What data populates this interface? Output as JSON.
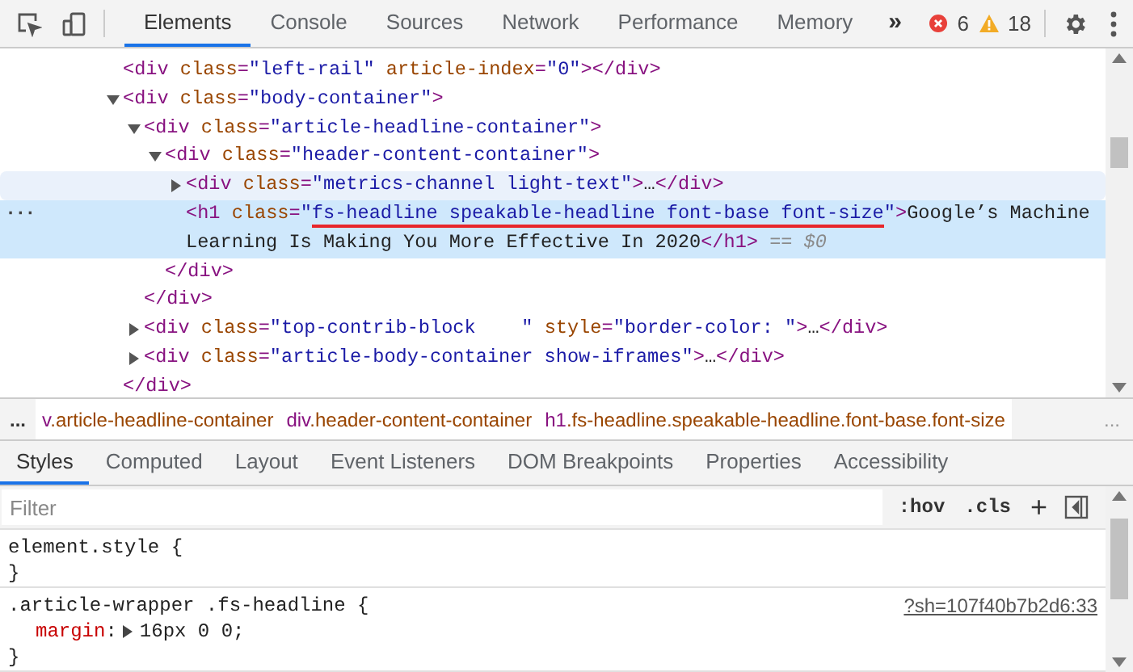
{
  "toolbar": {
    "tabs": [
      {
        "label": "Elements",
        "selected": true
      },
      {
        "label": "Console",
        "selected": false
      },
      {
        "label": "Sources",
        "selected": false
      },
      {
        "label": "Network",
        "selected": false
      },
      {
        "label": "Performance",
        "selected": false
      },
      {
        "label": "Memory",
        "selected": false
      }
    ],
    "overflow": "»",
    "errors": "6",
    "warnings": "18"
  },
  "dom_tree": [
    {
      "selected": false,
      "hovered": false,
      "open": [
        {
          "kind": "tag",
          "text": "<div"
        },
        {
          "kind": "attr",
          "text": " class"
        },
        {
          "kind": "tag",
          "text": "="
        },
        {
          "kind": "value",
          "text": "\"left-rail\""
        },
        {
          "kind": "attr",
          "text": " article-index"
        },
        {
          "kind": "tag",
          "text": "="
        },
        {
          "kind": "value",
          "text": "\"0\""
        },
        {
          "kind": "tag",
          "text": "></div>"
        }
      ]
    },
    {
      "expanded": true,
      "selected": false,
      "hovered": false,
      "open": [
        {
          "kind": "tag",
          "text": "<div"
        },
        {
          "kind": "attr",
          "text": " class"
        },
        {
          "kind": "tag",
          "text": "="
        },
        {
          "kind": "value",
          "text": "\"body-container\""
        },
        {
          "kind": "tag",
          "text": ">"
        }
      ],
      "children": [
        {
          "expanded": true,
          "selected": false,
          "hovered": false,
          "open": [
            {
              "kind": "tag",
              "text": "<div"
            },
            {
              "kind": "attr",
              "text": " class"
            },
            {
              "kind": "tag",
              "text": "="
            },
            {
              "kind": "value",
              "text": "\"article-headline-container\""
            },
            {
              "kind": "tag",
              "text": ">"
            }
          ],
          "children": [
            {
              "expanded": true,
              "selected": false,
              "hovered": false,
              "open": [
                {
                  "kind": "tag",
                  "text": "<div"
                },
                {
                  "kind": "attr",
                  "text": " class"
                },
                {
                  "kind": "tag",
                  "text": "="
                },
                {
                  "kind": "value",
                  "text": "\"header-content-container\""
                },
                {
                  "kind": "tag",
                  "text": ">"
                }
              ],
              "children": [
                {
                  "expanded": false,
                  "selected": false,
                  "hovered": true,
                  "open": [
                    {
                      "kind": "tag",
                      "text": "<div"
                    },
                    {
                      "kind": "attr",
                      "text": " class"
                    },
                    {
                      "kind": "tag",
                      "text": "="
                    },
                    {
                      "kind": "value",
                      "text": "\"metrics-channel light-text\""
                    },
                    {
                      "kind": "tag",
                      "text": ">"
                    },
                    {
                      "kind": "text",
                      "text": "…"
                    },
                    {
                      "kind": "tag",
                      "text": "</div>"
                    }
                  ]
                },
                {
                  "selected": true,
                  "hovered": false,
                  "gutter": "···",
                  "open": [
                    {
                      "kind": "tag",
                      "text": "<h1"
                    },
                    {
                      "kind": "attr",
                      "text": " class"
                    },
                    {
                      "kind": "tag",
                      "text": "="
                    },
                    {
                      "kind": "value",
                      "text": "\""
                    },
                    {
                      "kind": "marked",
                      "text": "fs-headline speakable-headline font-base font-size"
                    },
                    {
                      "kind": "value",
                      "text": "\""
                    },
                    {
                      "kind": "tag",
                      "text": ">"
                    },
                    {
                      "kind": "text",
                      "text": "Google’s Machine Learning Is Making You More Effective In 2020"
                    },
                    {
                      "kind": "tag",
                      "text": "</h1>"
                    },
                    {
                      "kind": "dim",
                      "text": " == $0"
                    }
                  ]
                }
              ],
              "close": [
                {
                  "kind": "tag",
                  "text": "</div>"
                }
              ]
            }
          ],
          "close": [
            {
              "kind": "tag",
              "text": "</div>"
            }
          ]
        },
        {
          "expanded": false,
          "selected": false,
          "hovered": false,
          "open": [
            {
              "kind": "tag",
              "text": "<div"
            },
            {
              "kind": "attr",
              "text": " class"
            },
            {
              "kind": "tag",
              "text": "="
            },
            {
              "kind": "value",
              "text": "\"top-contrib-block    \""
            },
            {
              "kind": "attr",
              "text": " style"
            },
            {
              "kind": "tag",
              "text": "="
            },
            {
              "kind": "value",
              "text": "\"border-color: \""
            },
            {
              "kind": "tag",
              "text": ">"
            },
            {
              "kind": "text",
              "text": "…"
            },
            {
              "kind": "tag",
              "text": "</div>"
            }
          ]
        },
        {
          "expanded": false,
          "selected": false,
          "hovered": false,
          "open": [
            {
              "kind": "tag",
              "text": "<div"
            },
            {
              "kind": "attr",
              "text": " class"
            },
            {
              "kind": "tag",
              "text": "="
            },
            {
              "kind": "value",
              "text": "\"article-body-container show-iframes\""
            },
            {
              "kind": "tag",
              "text": ">"
            },
            {
              "kind": "text",
              "text": "…"
            },
            {
              "kind": "tag",
              "text": "</div>"
            }
          ]
        }
      ],
      "close": [
        {
          "kind": "tag",
          "text": "</div>"
        }
      ]
    }
  ],
  "breadcrumbs": {
    "leading": "...",
    "trailing": "...",
    "items": [
      {
        "tag": "v",
        "classes": ".article-headline-container"
      },
      {
        "tag": "div",
        "classes": ".header-content-container"
      },
      {
        "tag": "h1",
        "classes": ".fs-headline.speakable-headline.font-base.font-size"
      }
    ]
  },
  "sidebar_tabs": [
    {
      "label": "Styles",
      "selected": true
    },
    {
      "label": "Computed",
      "selected": false
    },
    {
      "label": "Layout",
      "selected": false
    },
    {
      "label": "Event Listeners",
      "selected": false
    },
    {
      "label": "DOM Breakpoints",
      "selected": false
    },
    {
      "label": "Properties",
      "selected": false
    },
    {
      "label": "Accessibility",
      "selected": false
    }
  ],
  "filter": {
    "placeholder": "Filter",
    "hov": ":hov",
    "cls": ".cls",
    "add": "+"
  },
  "rules": [
    {
      "selector": "element.style {",
      "close": "}"
    },
    {
      "selector": ".article-wrapper .fs-headline {",
      "source": "?sh=107f40b7b2d6:33",
      "declarations": [
        {
          "property": "margin",
          "separator": ":",
          "value": "16px 0 0;"
        }
      ],
      "close": "}"
    }
  ]
}
